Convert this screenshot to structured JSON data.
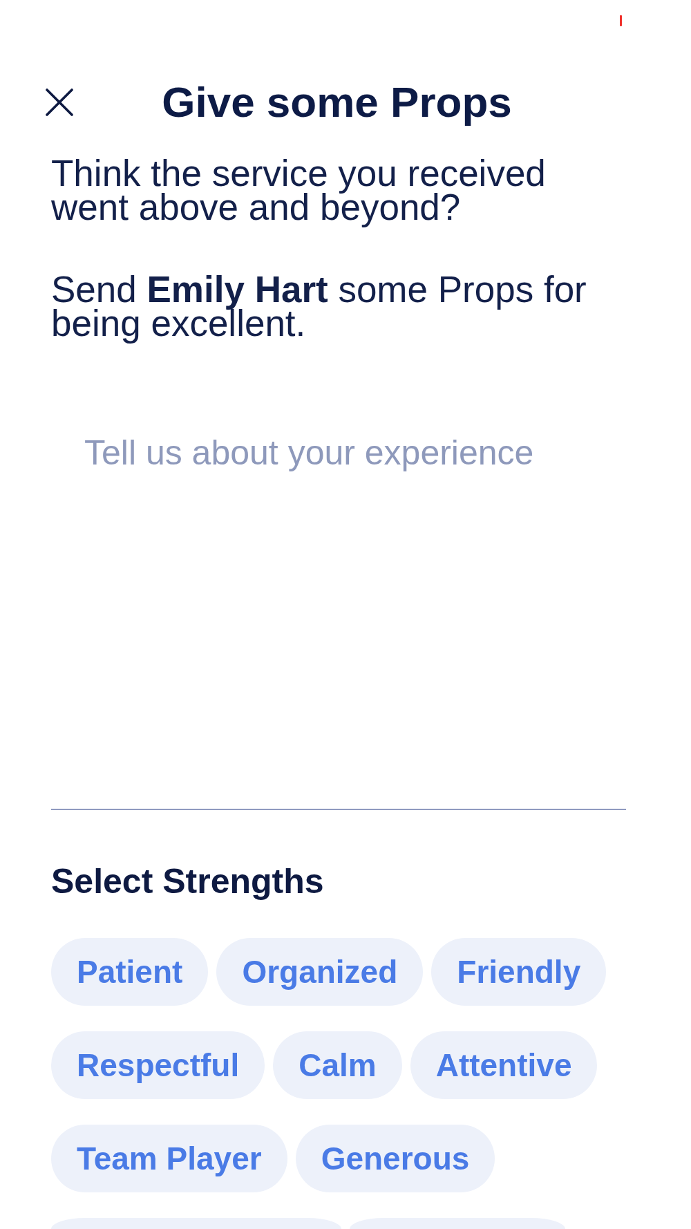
{
  "header": {
    "title": "Give some Props"
  },
  "intro": [
    "Think the service you received went above and beyond?",
    "Send **Emily Hart** some Props for being excellent."
  ],
  "experience_field": {
    "placeholder": "Tell us about your experience"
  },
  "strengths": {
    "heading": "Select Strengths",
    "items": [
      {
        "label": "Patient",
        "selected": false
      },
      {
        "label": "Organized",
        "selected": false
      },
      {
        "label": "Friendly",
        "selected": false
      },
      {
        "label": "Respectful",
        "selected": false
      },
      {
        "label": "Calm",
        "selected": false
      },
      {
        "label": "Attentive",
        "selected": false
      },
      {
        "label": "Team Player",
        "selected": false
      },
      {
        "label": "Generous",
        "selected": false
      },
      {
        "selected": false
      },
      {
        "selected": false
      }
    ]
  }
}
